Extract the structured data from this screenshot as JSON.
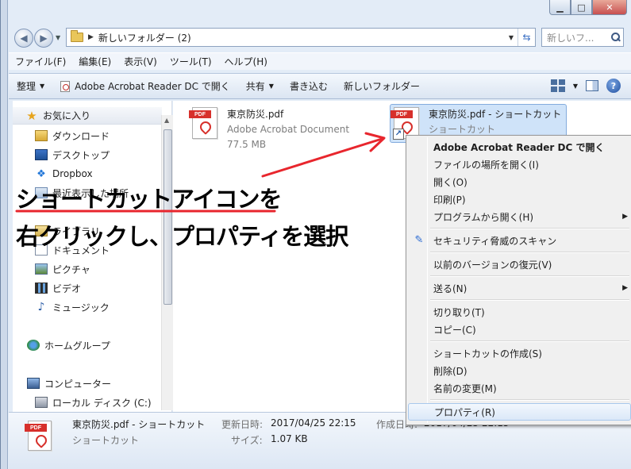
{
  "address": {
    "path": "新しいフォルダー (2)",
    "search_placeholder": "新しいフ..."
  },
  "menu": [
    "ファイル(F)",
    "編集(E)",
    "表示(V)",
    "ツール(T)",
    "ヘルプ(H)"
  ],
  "toolbar": {
    "organize": "整理",
    "open_with": "Adobe Acrobat Reader DC で開く",
    "share": "共有",
    "burn": "書き込む",
    "new_folder": "新しいフォルダー"
  },
  "nav": {
    "favorites": "お気に入り",
    "downloads": "ダウンロード",
    "desktop": "デスクトップ",
    "dropbox": "Dropbox",
    "recent": "最近表示した場所",
    "library_partial": "ライブラリ",
    "documents": "ドキュメント",
    "pictures": "ピクチャ",
    "videos": "ビデオ",
    "music": "ミュージック",
    "homegroup": "ホームグループ",
    "computer": "コンピューター",
    "local_disk": "ローカル ディスク (C:)"
  },
  "files": [
    {
      "name": "東京防災.pdf",
      "type": "Adobe Acrobat Document",
      "size": "77.5 MB"
    },
    {
      "name": "東京防災.pdf - ショートカット",
      "type": "ショートカット"
    }
  ],
  "annotation": {
    "line1": "ショートカットアイコンを",
    "line2": "右クリックし、プロパティを選択",
    "color": "#e8262d"
  },
  "context_menu": [
    "Adobe Acrobat Reader DC で開く",
    "ファイルの場所を開く(I)",
    "開く(O)",
    "印刷(P)",
    "プログラムから開く(H)",
    "セキュリティ脅威のスキャン",
    "以前のバージョンの復元(V)",
    "送る(N)",
    "切り取り(T)",
    "コピー(C)",
    "ショートカットの作成(S)",
    "削除(D)",
    "名前の変更(M)",
    "プロパティ(R)"
  ],
  "details": {
    "name": "東京防災.pdf - ショートカット",
    "type": "ショートカット",
    "modified_label": "更新日時:",
    "modified_value": "2017/04/25 22:15",
    "size_label": "サイズ:",
    "size_value": "1.07 KB",
    "created_label": "作成日時:",
    "created_value": "2017/04/25 22:15"
  },
  "pdf_tag": "PDF"
}
